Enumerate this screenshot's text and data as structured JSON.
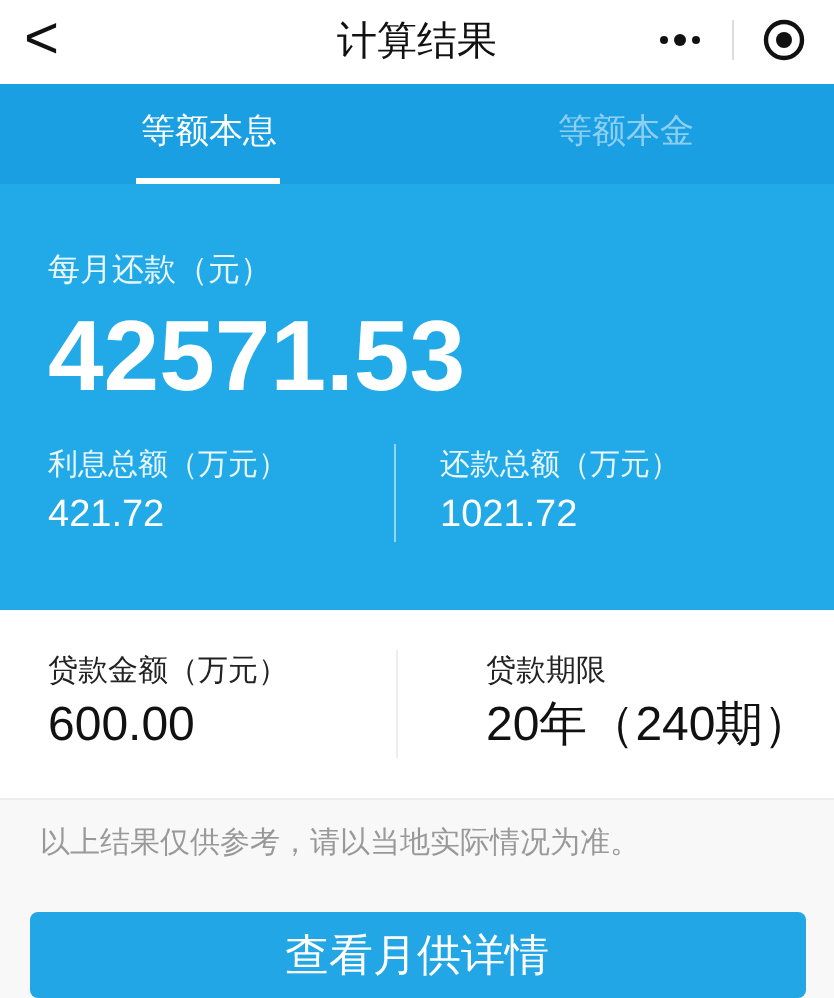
{
  "nav": {
    "back": "<",
    "title": "计算结果"
  },
  "tabs": [
    {
      "label": "等额本息",
      "selected": true
    },
    {
      "label": "等额本金",
      "selected": false
    }
  ],
  "monthly": {
    "label": "每月还款（元）",
    "value": "42571.53"
  },
  "summary": [
    {
      "label": "利息总额（万元）",
      "value": "421.72"
    },
    {
      "label": "还款总额（万元）",
      "value": "1021.72"
    }
  ],
  "loan": [
    {
      "label": "贷款金额（万元）",
      "value": "600.00"
    },
    {
      "label": "贷款期限",
      "value": "20年（240期）"
    }
  ],
  "note": "以上结果仅供参考，请以当地实际情况为准。",
  "button": "查看月供详情"
}
